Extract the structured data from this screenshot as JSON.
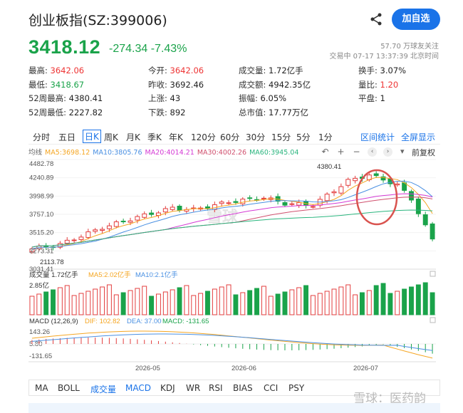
{
  "header": {
    "title": "创业板指(SZ:399006)",
    "follow_button": "加自选",
    "price": "3418.12",
    "change": "-274.34",
    "change_pct": "-7.43%",
    "followers": "57.70 万球友关注",
    "trade_time": "交易中 07-17 13:37:39 北京时间"
  },
  "stats": [
    [
      {
        "label": "最高:",
        "value": "3642.06",
        "color": "red"
      },
      {
        "label": "今开:",
        "value": "3642.06",
        "color": "red"
      },
      {
        "label": "成交量:",
        "value": "1.72亿手",
        "color": ""
      },
      {
        "label": "换手:",
        "value": "3.07%",
        "color": ""
      }
    ],
    [
      {
        "label": "最低:",
        "value": "3418.67",
        "color": "green"
      },
      {
        "label": "昨收:",
        "value": "3692.46",
        "color": ""
      },
      {
        "label": "成交额:",
        "value": "4942.35亿",
        "color": ""
      },
      {
        "label": "量比:",
        "value": "1.20",
        "color": "red"
      }
    ],
    [
      {
        "label": "52周最高:",
        "value": "4380.41",
        "color": ""
      },
      {
        "label": "上涨:",
        "value": "43",
        "color": ""
      },
      {
        "label": "振幅:",
        "value": "6.05%",
        "color": ""
      },
      {
        "label": "平盘:",
        "value": "1",
        "color": ""
      }
    ],
    [
      {
        "label": "52周最低:",
        "value": "2227.82",
        "color": ""
      },
      {
        "label": "下跌:",
        "value": "892",
        "color": ""
      },
      {
        "label": "总市值:",
        "value": "17.77万亿",
        "color": ""
      },
      {
        "label": "",
        "value": "",
        "color": ""
      }
    ]
  ],
  "period_tabs": [
    "分时",
    "五日",
    "日K",
    "周K",
    "月K",
    "季K",
    "年K",
    "120分",
    "60分",
    "30分",
    "15分",
    "5分",
    "1分"
  ],
  "period_active": "日K",
  "tab_right": [
    "区间统计",
    "全屏显示"
  ],
  "ma_legend": [
    {
      "label": "均线",
      "color": "#666666"
    },
    {
      "label": "MA5:3698.12",
      "color": "#f5a623"
    },
    {
      "label": "MA10:3805.76",
      "color": "#4a90e2"
    },
    {
      "label": "MA20:4014.21",
      "color": "#d43ad4"
    },
    {
      "label": "MA30:4002.26",
      "color": "#d0506e"
    },
    {
      "label": "MA60:3945.04",
      "color": "#2ab57e"
    }
  ],
  "chart_controls": {
    "reset": "↶",
    "plus": "+",
    "minus": "−",
    "prev": "‹",
    "next": "›",
    "adjust": "前复权"
  },
  "chart_data": {
    "type": "candlestick",
    "y_ticks": [
      "4482.78",
      "4240.89",
      "3998.99",
      "3757.10",
      "3515.20",
      "3273.31",
      "3031.41"
    ],
    "ylim": [
      3031.41,
      4482.78
    ],
    "high_label": "4380.41",
    "low_label": "2113.78",
    "x_labels": [
      "2026-05",
      "2026-06",
      "2026-07"
    ],
    "volume": {
      "legend": "成交量 1.72亿手",
      "ma5": "MA5:2.02亿手",
      "ma10": "MA10:2.1亿手",
      "y_tick": "2.85亿"
    },
    "macd": {
      "legend": "MACD (12,26,9)",
      "dif": "DIF: 102.82",
      "dea": "DEA: 37.00",
      "macd": "MACD: -131.65",
      "y_ticks": [
        "143.26",
        "5.80",
        "-131.65"
      ]
    }
  },
  "indicator_tabs": [
    "MA",
    "BOLL",
    "成交量",
    "MACD",
    "KDJ",
    "WR",
    "RSI",
    "BIAS",
    "CCI",
    "PSY"
  ],
  "indicator_active": [
    "成交量",
    "MACD"
  ],
  "watermark": "雪球：医药韵",
  "colors": {
    "up": "#e33e3e",
    "down": "#1aa34a",
    "accent": "#1a73e8"
  }
}
